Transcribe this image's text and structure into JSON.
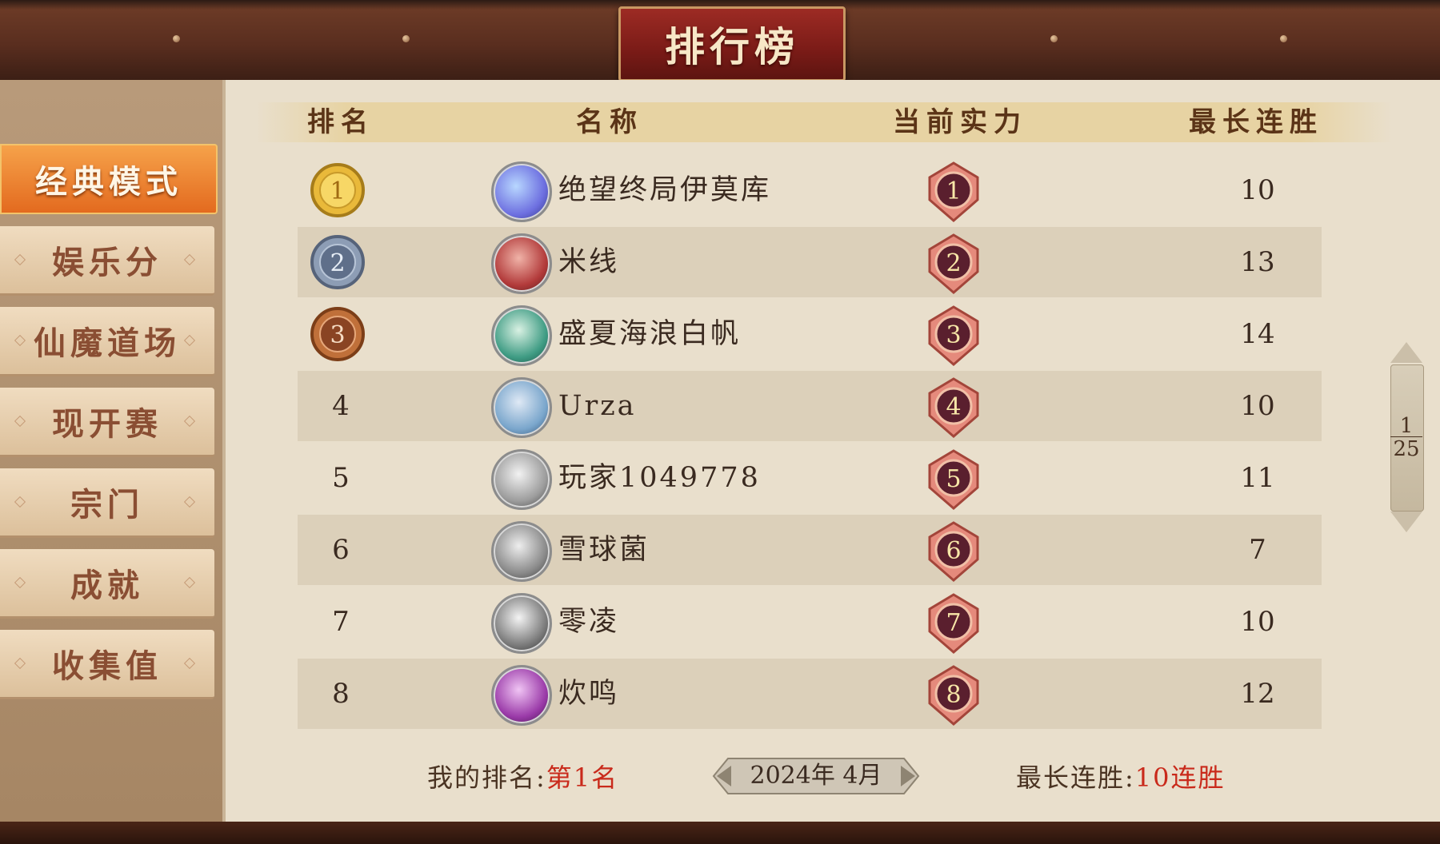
{
  "title": "排行榜",
  "sidebar": {
    "items": [
      {
        "label": "经典模式",
        "active": true
      },
      {
        "label": "娱乐分"
      },
      {
        "label": "仙魔道场"
      },
      {
        "label": "现开赛"
      },
      {
        "label": "宗门"
      },
      {
        "label": "成就"
      },
      {
        "label": "收集值"
      }
    ]
  },
  "table": {
    "headers": [
      "排名",
      "名称",
      "当前实力",
      "最长连胜"
    ],
    "rows": [
      {
        "rank": "1",
        "name": "绝望终局伊莫库",
        "power": "1",
        "max_streak": "10"
      },
      {
        "rank": "2",
        "name": "米线",
        "power": "2",
        "max_streak": "13"
      },
      {
        "rank": "3",
        "name": "盛夏海浪白帆",
        "power": "3",
        "max_streak": "14"
      },
      {
        "rank": "4",
        "name": "Urza",
        "power": "4",
        "max_streak": "10"
      },
      {
        "rank": "5",
        "name": "玩家1049778",
        "power": "5",
        "max_streak": "11"
      },
      {
        "rank": "6",
        "name": "雪球菌",
        "power": "6",
        "max_streak": "7"
      },
      {
        "rank": "7",
        "name": "零凌",
        "power": "7",
        "max_streak": "10"
      },
      {
        "rank": "8",
        "name": "炊鸣",
        "power": "8",
        "max_streak": "12"
      }
    ]
  },
  "footer": {
    "my_rank_label": "我的排名:",
    "my_rank_value": "第1名",
    "date": "2024年 4月",
    "max_streak_label": "最长连胜:",
    "max_streak_value": "10连胜"
  },
  "pager": {
    "current": "1",
    "total": "25"
  },
  "colors": {
    "gold": "#e9b93a",
    "silver": "#7e8fa8",
    "bronze": "#c0703a",
    "accent_red": "#c92a1b",
    "active_tab": "#e36a1f"
  }
}
